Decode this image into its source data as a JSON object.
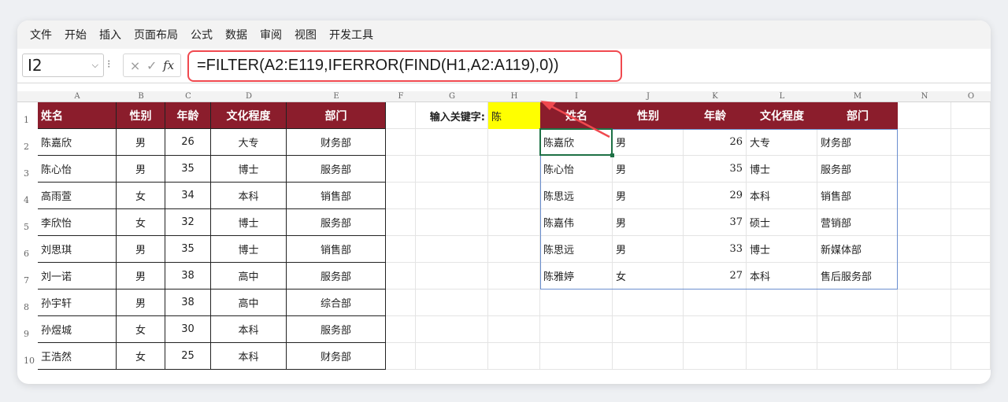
{
  "ribbon": {
    "tabs": [
      "文件",
      "开始",
      "插入",
      "页面布局",
      "公式",
      "数据",
      "审阅",
      "视图",
      "开发工具"
    ]
  },
  "formula_bar": {
    "name_box": "I2",
    "cancel_icon": "×",
    "enter_icon": "✓",
    "fx_label": "fx",
    "formula": "=FILTER(A2:E119,IFERROR(FIND(H1,A2:A119),0))"
  },
  "column_headers": [
    "A",
    "B",
    "C",
    "D",
    "E",
    "F",
    "G",
    "H",
    "I",
    "J",
    "K",
    "L",
    "M",
    "N",
    "O"
  ],
  "row_headers": [
    "1",
    "2",
    "3",
    "4",
    "5",
    "6",
    "7",
    "8",
    "9",
    "10"
  ],
  "source_table": {
    "headers": [
      "姓名",
      "性别",
      "年龄",
      "文化程度",
      "部门"
    ],
    "rows": [
      [
        "陈嘉欣",
        "男",
        "26",
        "大专",
        "财务部"
      ],
      [
        "陈心怡",
        "男",
        "35",
        "博士",
        "服务部"
      ],
      [
        "高雨萱",
        "女",
        "34",
        "本科",
        "销售部"
      ],
      [
        "李欣怡",
        "女",
        "32",
        "博士",
        "服务部"
      ],
      [
        "刘思琪",
        "男",
        "35",
        "博士",
        "销售部"
      ],
      [
        "刘一诺",
        "男",
        "38",
        "高中",
        "服务部"
      ],
      [
        "孙宇轩",
        "男",
        "38",
        "高中",
        "综合部"
      ],
      [
        "孙煜城",
        "女",
        "30",
        "本科",
        "服务部"
      ],
      [
        "王浩然",
        "女",
        "25",
        "本科",
        "财务部"
      ]
    ]
  },
  "keyword": {
    "label": "输入关键字:",
    "value": "陈"
  },
  "result_table": {
    "headers": [
      "姓名",
      "性别",
      "年龄",
      "文化程度",
      "部门"
    ],
    "rows": [
      [
        "陈嘉欣",
        "男",
        "26",
        "大专",
        "财务部"
      ],
      [
        "陈心怡",
        "男",
        "35",
        "博士",
        "服务部"
      ],
      [
        "陈思远",
        "男",
        "29",
        "本科",
        "销售部"
      ],
      [
        "陈嘉伟",
        "男",
        "37",
        "硕士",
        "营销部"
      ],
      [
        "陈思远",
        "男",
        "33",
        "博士",
        "新媒体部"
      ],
      [
        "陈雅婷",
        "女",
        "27",
        "本科",
        "售后服务部"
      ]
    ]
  },
  "colors": {
    "header_fill": "#8b1d2c",
    "keyword_fill": "#ffff00",
    "highlight_outline": "#f0494f",
    "active_cell": "#1e7145"
  }
}
